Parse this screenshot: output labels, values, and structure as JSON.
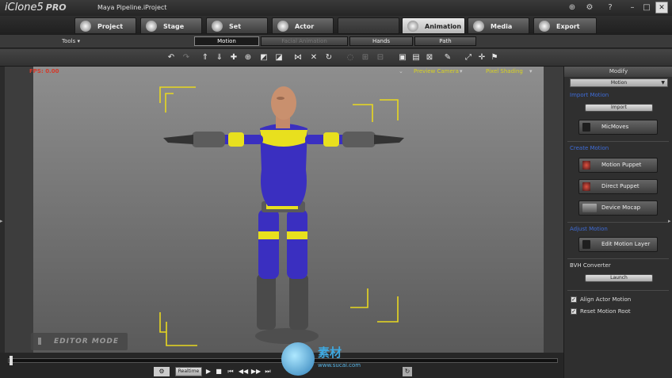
{
  "app": {
    "logo": "iClone5",
    "edition": "PRO",
    "project": "Maya Pipeline.iProject"
  },
  "tabs": [
    {
      "label": "Project",
      "state": "normal"
    },
    {
      "label": "Stage",
      "state": "normal"
    },
    {
      "label": "Set",
      "state": "normal"
    },
    {
      "label": "Actor",
      "state": "normal"
    },
    {
      "label": "",
      "state": "disabled"
    },
    {
      "label": "Animation",
      "state": "active"
    },
    {
      "label": "Media",
      "state": "normal"
    },
    {
      "label": "Export",
      "state": "normal"
    }
  ],
  "subbar": {
    "tools": "Tools ▾",
    "subtabs": [
      {
        "label": "Motion",
        "state": "active"
      },
      {
        "label": "Facial Animation",
        "state": "dim"
      },
      {
        "label": "Hands",
        "state": "normal"
      },
      {
        "label": "Path",
        "state": "normal"
      }
    ]
  },
  "toolbar_icons": [
    "undo-icon",
    "redo-icon",
    "move-up-icon",
    "move-down-icon",
    "move-icon",
    "rotate-icon",
    "scale-icon",
    "snap-icon",
    "align-icon",
    "link-icon",
    "reset-icon",
    "hide-icon",
    "lock-icon",
    "attach-icon",
    "camera-icon",
    "screen-icon",
    "grid-icon",
    "light-icon",
    "fullscreen-icon",
    "flag-icon"
  ],
  "viewport": {
    "fps": "FPS: 0.00",
    "camera": "Preview Camera",
    "shading": "Pixel Shading",
    "mode": "EDITOR MODE"
  },
  "timeline": {
    "realtime": "Realtime",
    "controls": [
      "▶",
      "■",
      "⏮",
      "◀◀",
      "▶▶",
      "⏭",
      "↻"
    ]
  },
  "panel": {
    "title": "Modify",
    "dropdown": "Motion",
    "import_section": "Import Motion",
    "import_button": "Import",
    "micmoves_button": "MicMoves",
    "create_section": "Create Motion",
    "motion_puppet": "Motion Puppet",
    "direct_puppet": "Direct Puppet",
    "device_mocap": "Device Mocap",
    "adjust_section": "Adjust Motion",
    "edit_motion_layer": "Edit Motion Layer",
    "bvh_section": "BVH Converter",
    "launch_button": "Launch",
    "check_align": "Align Actor Motion",
    "check_reset": "Reset Motion Root"
  },
  "watermark": {
    "text": "素材",
    "url": "www.sucai.com"
  },
  "colors": {
    "accent_blue": "#3e6cd8",
    "fps_red": "#d43a2a",
    "camera_yellow": "#d8d220",
    "suit_blue": "#3a2fc0",
    "suit_yellow": "#e8e01e"
  }
}
